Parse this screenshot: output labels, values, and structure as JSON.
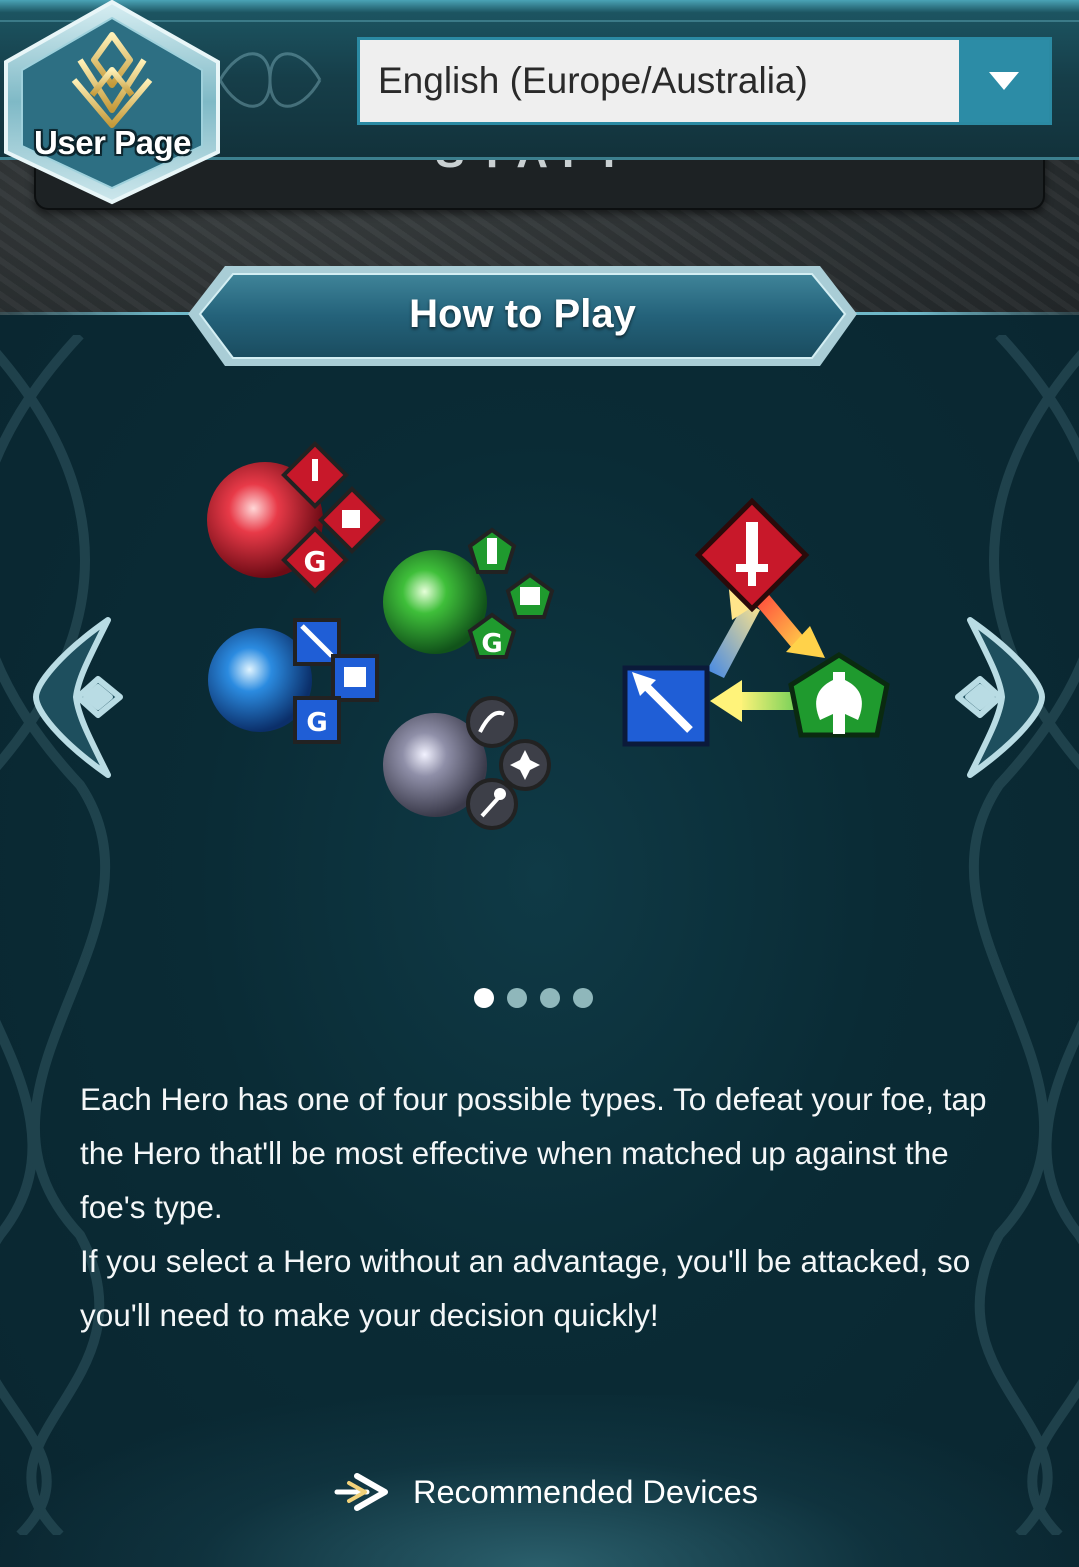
{
  "header": {
    "user_page_label": "User Page",
    "language_select": {
      "selected": "English (Europe/Australia)"
    },
    "staff_text": "STAFF"
  },
  "main": {
    "title": "How to Play",
    "carousel": {
      "pages": 4,
      "active_page": 1
    },
    "description": [
      "Each Hero has one of four possible types. To defeat your foe, tap the Hero that'll be most effective when matched up against the foe's type.",
      "If you select a Hero without an advantage, you'll be attacked, so you'll need to make your decision quickly!"
    ],
    "recommended_link": "Recommended Devices"
  },
  "icons": {
    "badge": "crest-icon",
    "dropdown": "chevron-down-icon",
    "prev": "arrow-left-icon",
    "next": "arrow-right-icon",
    "link": "double-arrow-icon"
  },
  "colors": {
    "red": "#d21f2e",
    "blue": "#1f5ed6",
    "green": "#1f9a2e",
    "colorless": "#5a5a6a",
    "accent": "#2c8ca6"
  }
}
